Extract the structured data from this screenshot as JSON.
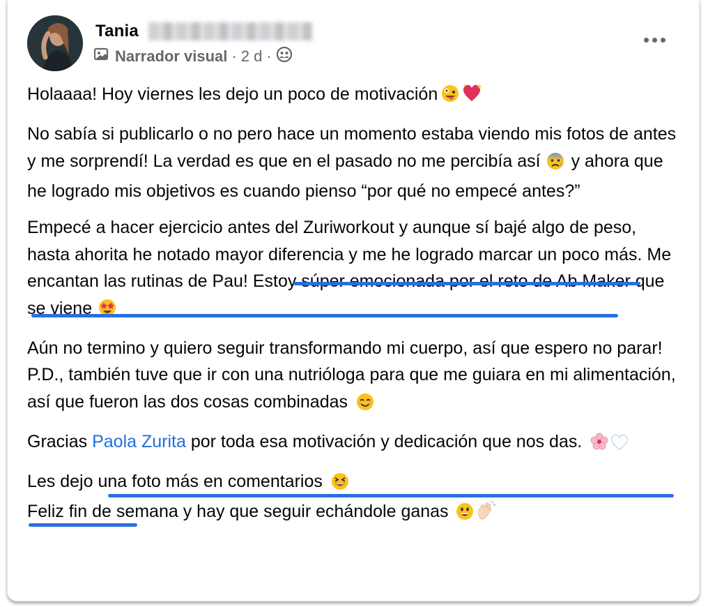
{
  "post": {
    "author": "Tania",
    "source": "Narrador visual",
    "time": "2 d",
    "separator": "·",
    "paragraphs": {
      "p1": "Holaaaa! Hoy viernes les dejo un poco de motivación",
      "p2a": "No sabía si publicarlo o no pero hace un momento estaba viendo mis fotos de antes y me sorprendí! La verdad es que en el pasado no me percibía así",
      "p2b": "y ahora que he logrado mis objetivos es cuando pienso “por qué no empecé antes?”",
      "p3": "Empecé a hacer ejercicio antes del Zuriworkout y aunque sí bajé algo de peso, hasta ahorita he notado mayor diferencia y me he logrado marcar un poco más. Me encantan las rutinas de Pau! Estoy súper emocionada por el reto de Ab Maker que se viene",
      "p4": "Aún no termino y quiero seguir transformando mi cuerpo, así que espero no parar!",
      "p5": "P.D., también tuve que ir con una nutrióloga para que me guiara en mi alimentación, así que fueron las dos cosas combinadas",
      "p6_prefix": "Gracias",
      "p6_mention": "Paola Zurita",
      "p6_suffix": "por toda esa motivación y dedicación que nos das.",
      "p7": "Les dejo una foto más en comentarios",
      "p8": "Feliz fin de semana y hay que seguir echándole ganas"
    }
  },
  "colors": {
    "mention": "#216fdb",
    "highlight_underline": "#2a6fe0",
    "meta_text": "#65676b"
  },
  "icons": [
    "image-icon",
    "globe-friends-icon",
    "more-options-icon",
    "zany-face-emoji",
    "sparkling-heart-emoji",
    "anxious-face-emoji",
    "star-struck-emoji",
    "smiling-face-emoji",
    "cherry-blossom-emoji",
    "white-heart-emoji",
    "grinning-squinting-emoji",
    "grinning-face-emoji",
    "clapping-hands-emoji"
  ]
}
